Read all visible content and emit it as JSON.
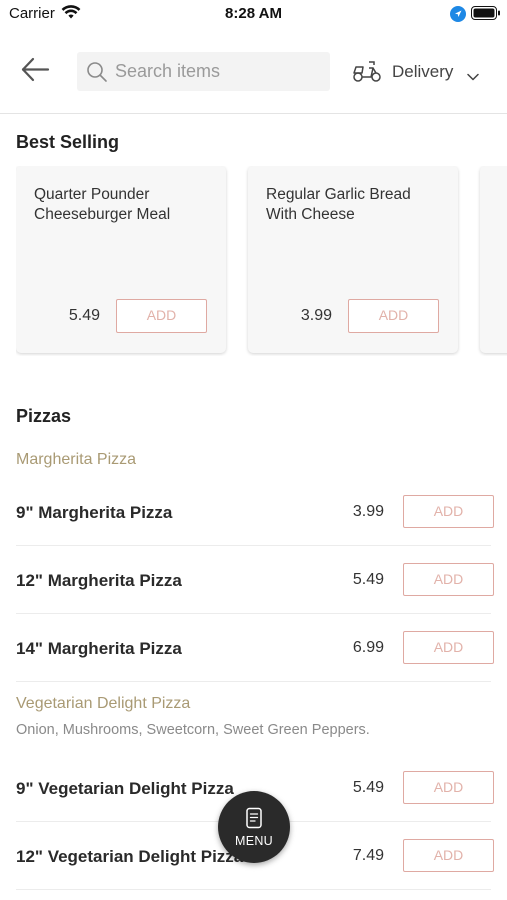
{
  "status_bar": {
    "carrier": "Carrier",
    "time": "8:28 AM"
  },
  "header": {
    "search_placeholder": "Search items",
    "delivery_label": "Delivery"
  },
  "colors": {
    "accent": "#dfa9a2",
    "subcategory": "#a99a74",
    "fab": "#2a2a2a"
  },
  "best_selling": {
    "title": "Best Selling",
    "items": [
      {
        "name": "Quarter Pounder Cheeseburger Meal",
        "price": "5.49",
        "add_label": "ADD"
      },
      {
        "name": "Regular Garlic Bread With Cheese",
        "price": "3.99",
        "add_label": "ADD"
      }
    ]
  },
  "pizzas": {
    "title": "Pizzas",
    "groups": [
      {
        "name": "Margherita Pizza",
        "description": "",
        "items": [
          {
            "name": "9\" Margherita Pizza",
            "price": "3.99",
            "add_label": "ADD"
          },
          {
            "name": "12\" Margherita Pizza",
            "price": "5.49",
            "add_label": "ADD"
          },
          {
            "name": "14\" Margherita Pizza",
            "price": "6.99",
            "add_label": "ADD"
          }
        ]
      },
      {
        "name": "Vegetarian Delight Pizza",
        "description": "Onion, Mushrooms, Sweetcorn, Sweet Green Peppers.",
        "items": [
          {
            "name": "9\" Vegetarian Delight Pizza",
            "price": "5.49",
            "add_label": "ADD"
          },
          {
            "name": "12\" Vegetarian Delight Pizza",
            "price": "7.49",
            "add_label": "ADD"
          }
        ]
      }
    ]
  },
  "fab": {
    "label": "MENU"
  }
}
